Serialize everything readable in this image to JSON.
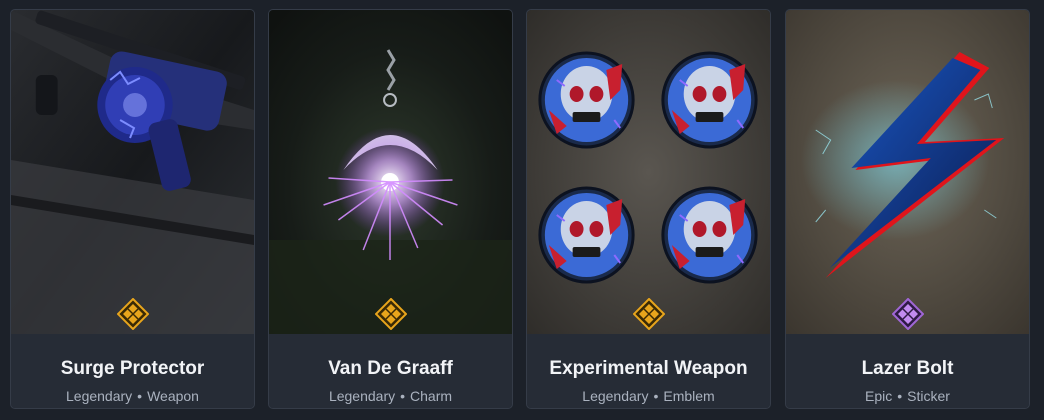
{
  "items": [
    {
      "name": "Surge Protector",
      "rarity": "Legendary",
      "type": "Weapon",
      "rarity_color": "#e8a51c",
      "icon": "assault-rifle-icon"
    },
    {
      "name": "Van De Graaff",
      "rarity": "Legendary",
      "type": "Charm",
      "rarity_color": "#e8a51c",
      "icon": "plasma-charm-icon"
    },
    {
      "name": "Experimental Weapon",
      "rarity": "Legendary",
      "type": "Emblem",
      "rarity_color": "#e8a51c",
      "icon": "skull-emblem-icon"
    },
    {
      "name": "Lazer Bolt",
      "rarity": "Epic",
      "type": "Sticker",
      "rarity_color": "#a066d6",
      "icon": "lightning-bolt-icon"
    }
  ],
  "separator": "•"
}
